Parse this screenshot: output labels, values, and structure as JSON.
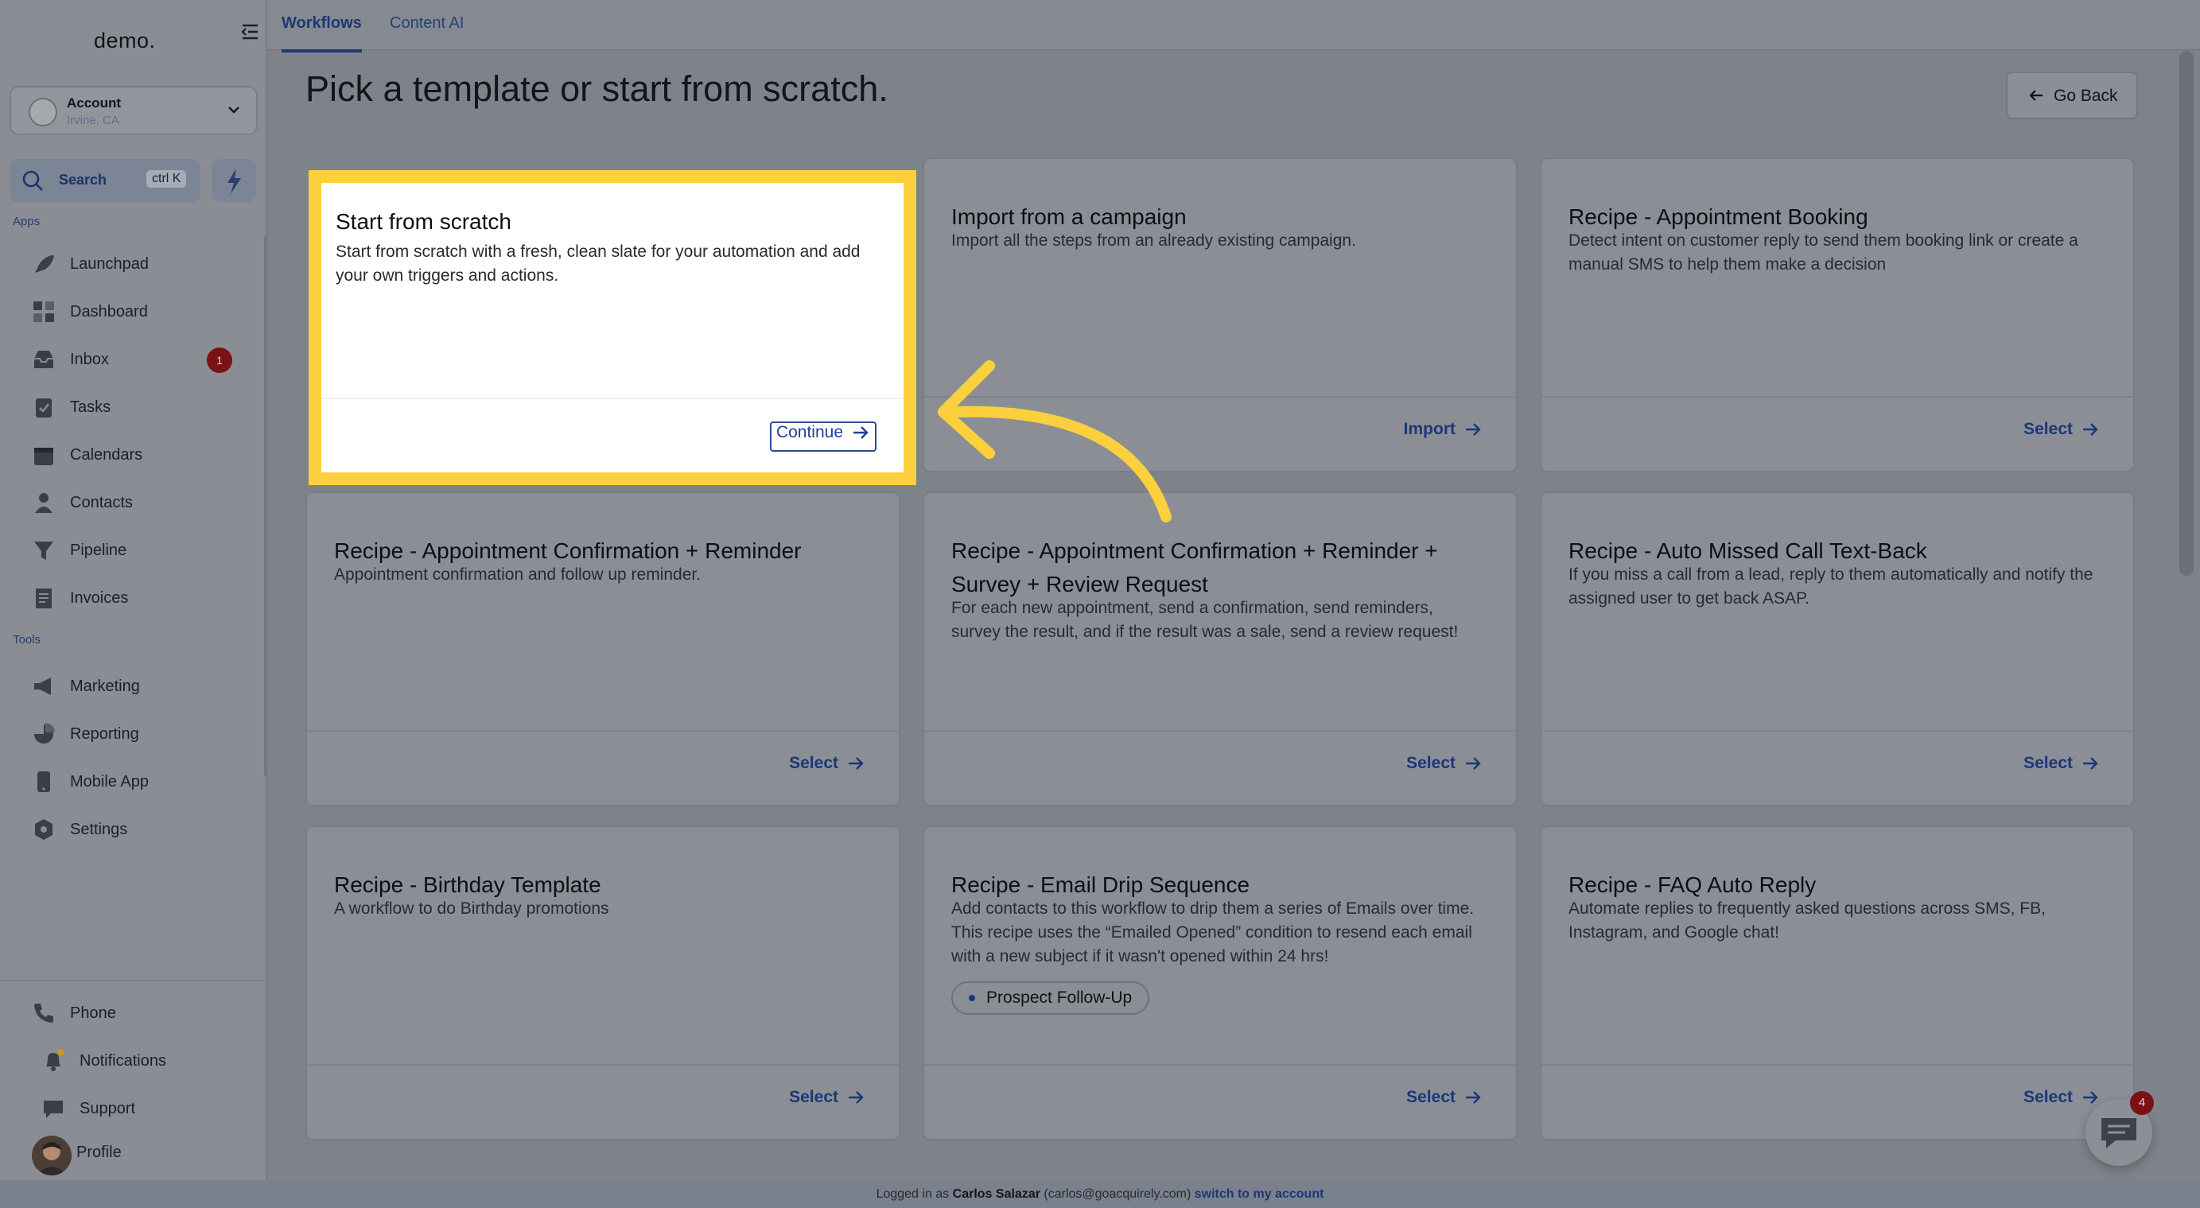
{
  "sidebar": {
    "logo": "demo.",
    "account": {
      "name": "Account",
      "location": "Irvine, CA"
    },
    "search": {
      "label": "Search",
      "shortcut": "ctrl K"
    },
    "apps_label": "Apps",
    "tools_label": "Tools",
    "apps": [
      {
        "label": "Launchpad",
        "icon": "rocket-icon"
      },
      {
        "label": "Dashboard",
        "icon": "dashboard-icon"
      },
      {
        "label": "Inbox",
        "icon": "inbox-icon",
        "badge": "1"
      },
      {
        "label": "Tasks",
        "icon": "tasks-icon"
      },
      {
        "label": "Calendars",
        "icon": "calendar-icon"
      },
      {
        "label": "Contacts",
        "icon": "contacts-icon"
      },
      {
        "label": "Pipeline",
        "icon": "pipeline-icon"
      },
      {
        "label": "Invoices",
        "icon": "invoice-icon"
      }
    ],
    "tools": [
      {
        "label": "Marketing",
        "icon": "megaphone-icon"
      },
      {
        "label": "Reporting",
        "icon": "pie-chart-icon"
      },
      {
        "label": "Mobile App",
        "icon": "mobile-icon"
      },
      {
        "label": "Settings",
        "icon": "gear-icon"
      }
    ],
    "bottom": [
      {
        "label": "Phone",
        "icon": "phone-icon"
      },
      {
        "label": "Notifications",
        "icon": "bell-icon"
      },
      {
        "label": "Support",
        "icon": "chat-icon"
      },
      {
        "label": "Profile",
        "icon": "profile-avatar"
      }
    ]
  },
  "tabs": [
    "Workflows",
    "Content AI"
  ],
  "page": {
    "title": "Pick a template or start from scratch.",
    "go_back": "Go Back"
  },
  "cards": [
    {
      "title": "Start from scratch",
      "desc": "Start from scratch with a fresh, clean slate for your automation and add your own triggers and actions.",
      "action": "Continue"
    },
    {
      "title": "Import from a campaign",
      "desc": "Import all the steps from an already existing campaign.",
      "action": "Import"
    },
    {
      "title": "Recipe - Appointment Booking",
      "desc": "Detect intent on customer reply to send them booking link or create a manual SMS to help them make a decision",
      "action": "Select"
    },
    {
      "title": "Recipe - Appointment Confirmation + Reminder",
      "desc": "Appointment confirmation and follow up reminder.",
      "action": "Select"
    },
    {
      "title": "Recipe - Appointment Confirmation + Reminder + Survey + Review Request",
      "desc": "For each new appointment, send a confirmation, send reminders, survey the result, and if the result was a sale, send a review request!",
      "action": "Select"
    },
    {
      "title": "Recipe - Auto Missed Call Text-Back",
      "desc": "If you miss a call from a lead, reply to them automatically and notify the assigned user to get back ASAP.",
      "action": "Select"
    },
    {
      "title": "Recipe - Birthday Template",
      "desc": "A workflow to do Birthday promotions",
      "action": "Select"
    },
    {
      "title": "Recipe - Email Drip Sequence",
      "desc": "Add contacts to this workflow to drip them a series of Emails over time. This recipe uses the “Emailed Opened” condition to resend each email with a new subject if it wasn't opened within 24 hrs!",
      "action": "Select",
      "tag": "Prospect Follow-Up"
    },
    {
      "title": "Recipe - FAQ Auto Reply",
      "desc": "Automate replies to frequently asked questions across SMS, FB, Instagram, and Google chat!",
      "action": "Select"
    }
  ],
  "footer": {
    "prefix": "Logged in as",
    "user": "Carlos Salazar",
    "email": "(carlos@goacquirely.com)",
    "link": "switch to my account"
  },
  "chat_widget": {
    "badge": "4"
  },
  "colors": {
    "highlight": "#fcd03d",
    "accent": "#1d3777",
    "badge": "#7a1115"
  }
}
